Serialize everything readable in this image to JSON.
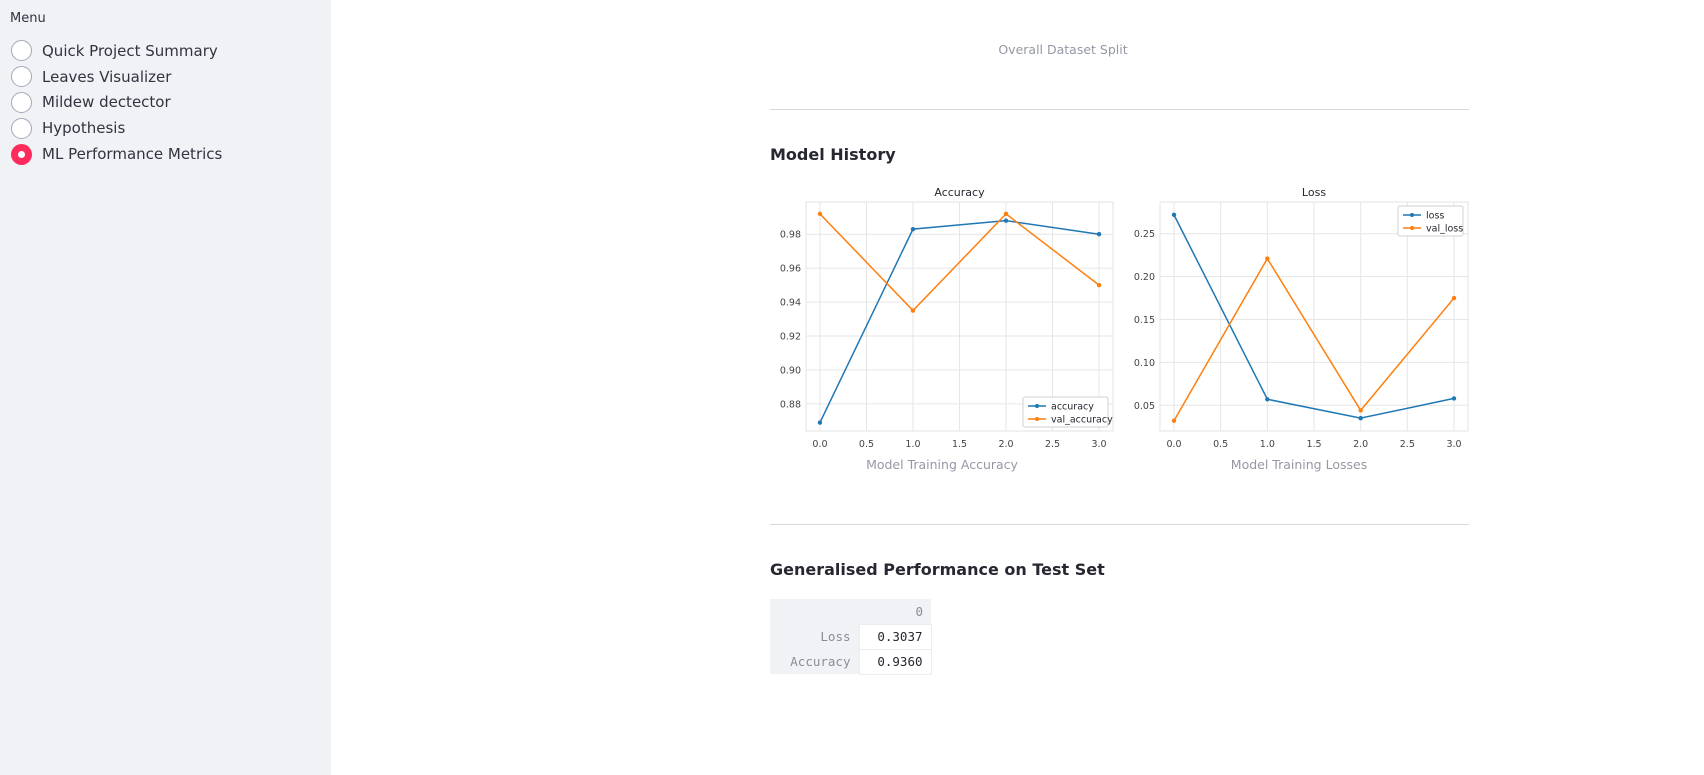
{
  "sidebar": {
    "menu_label": "Menu",
    "items": [
      {
        "label": "Quick Project Summary",
        "selected": false
      },
      {
        "label": "Leaves Visualizer",
        "selected": false
      },
      {
        "label": "Mildew dectector",
        "selected": false
      },
      {
        "label": "Hypothesis",
        "selected": false
      },
      {
        "label": "ML Performance Metrics",
        "selected": true
      }
    ]
  },
  "main": {
    "dataset_caption": "Overall Dataset Split",
    "model_history_heading": "Model History",
    "accuracy_caption": "Model Training Accuracy",
    "loss_caption": "Model Training Losses",
    "generalised_heading": "Generalised Performance on Test Set",
    "table": {
      "column_header": "0",
      "rows": [
        {
          "label": "Loss",
          "value": "0.3037"
        },
        {
          "label": "Accuracy",
          "value": "0.9360"
        }
      ]
    }
  },
  "colors": {
    "blue": "#1f77b4",
    "orange": "#ff7f0e",
    "accent": "#ff2b5c"
  },
  "chart_data": [
    {
      "type": "line",
      "title": "Accuracy",
      "x": [
        0,
        1,
        2,
        3
      ],
      "xticks": [
        "0.0",
        "0.5",
        "1.0",
        "1.5",
        "2.0",
        "2.5",
        "3.0"
      ],
      "yticks": [
        "0.88",
        "0.90",
        "0.92",
        "0.94",
        "0.96",
        "0.98"
      ],
      "xlim": [
        -0.15,
        3.15
      ],
      "ylim": [
        0.864,
        0.999
      ],
      "legend_position": "lower right",
      "grid": true,
      "series": [
        {
          "name": "accuracy",
          "values": [
            0.869,
            0.983,
            0.988,
            0.98
          ]
        },
        {
          "name": "val_accuracy",
          "values": [
            0.992,
            0.935,
            0.992,
            0.95
          ]
        }
      ]
    },
    {
      "type": "line",
      "title": "Loss",
      "x": [
        0,
        1,
        2,
        3
      ],
      "xticks": [
        "0.0",
        "0.5",
        "1.0",
        "1.5",
        "2.0",
        "2.5",
        "3.0"
      ],
      "yticks": [
        "0.05",
        "0.10",
        "0.15",
        "0.20",
        "0.25"
      ],
      "xlim": [
        -0.15,
        3.15
      ],
      "ylim": [
        0.02,
        0.287
      ],
      "legend_position": "upper right",
      "grid": true,
      "series": [
        {
          "name": "loss",
          "values": [
            0.272,
            0.057,
            0.035,
            0.058
          ]
        },
        {
          "name": "val_loss",
          "values": [
            0.032,
            0.221,
            0.044,
            0.175
          ]
        }
      ]
    }
  ]
}
